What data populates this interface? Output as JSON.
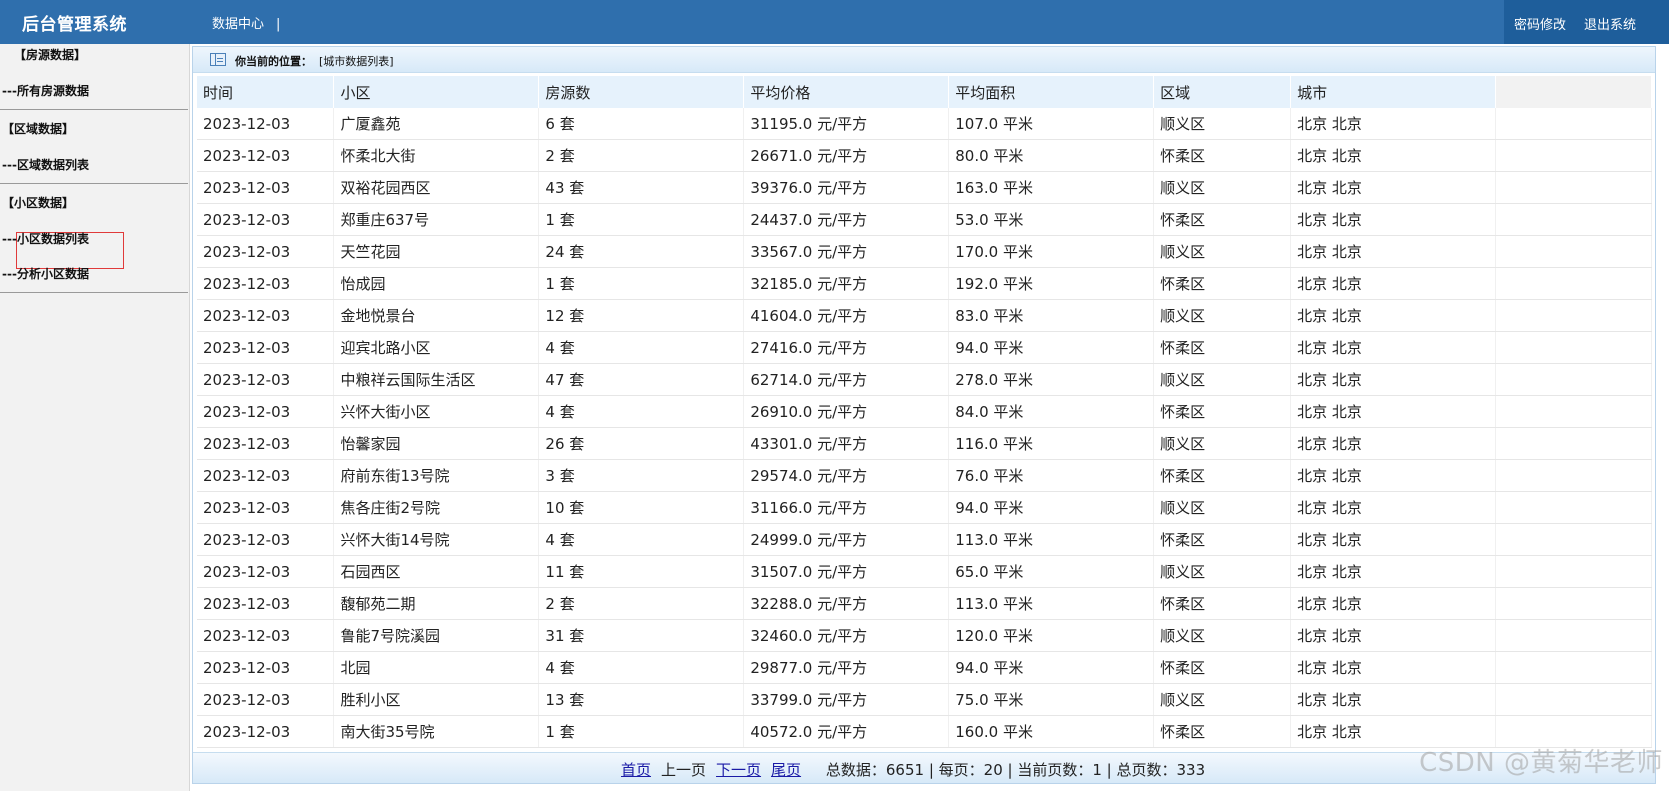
{
  "header": {
    "title": "后台管理系统",
    "nav": "数据中心",
    "nav_sep": "|",
    "password_change": "密码修改",
    "logout": "退出系统"
  },
  "sidebar": {
    "groups": [
      {
        "title": "【房源数据】",
        "items": [
          "---所有房源数据"
        ]
      },
      {
        "title": "【区域数据】",
        "items": [
          "---区域数据列表"
        ]
      },
      {
        "title": "【小区数据】",
        "items": [
          "---小区数据列表",
          "---分析小区数据"
        ]
      }
    ],
    "active_item": "---小区数据列表"
  },
  "location": {
    "label": "你当前的位置：",
    "value": "[城市数据列表]"
  },
  "table": {
    "columns": [
      "时间",
      "小区",
      "房源数",
      "平均价格",
      "平均面积",
      "区域",
      "城市"
    ],
    "rows": [
      [
        "2023-12-03",
        "广厦鑫苑",
        "6 套",
        "31195.0 元/平方",
        "107.0 平米",
        "顺义区",
        "北京 北京"
      ],
      [
        "2023-12-03",
        "怀柔北大街",
        "2 套",
        "26671.0 元/平方",
        "80.0 平米",
        "怀柔区",
        "北京 北京"
      ],
      [
        "2023-12-03",
        "双裕花园西区",
        "43 套",
        "39376.0 元/平方",
        "163.0 平米",
        "顺义区",
        "北京 北京"
      ],
      [
        "2023-12-03",
        "郑重庄637号",
        "1 套",
        "24437.0 元/平方",
        "53.0 平米",
        "怀柔区",
        "北京 北京"
      ],
      [
        "2023-12-03",
        "天竺花园",
        "24 套",
        "33567.0 元/平方",
        "170.0 平米",
        "顺义区",
        "北京 北京"
      ],
      [
        "2023-12-03",
        "怡成园",
        "1 套",
        "32185.0 元/平方",
        "192.0 平米",
        "怀柔区",
        "北京 北京"
      ],
      [
        "2023-12-03",
        "金地悦景台",
        "12 套",
        "41604.0 元/平方",
        "83.0 平米",
        "顺义区",
        "北京 北京"
      ],
      [
        "2023-12-03",
        "迎宾北路小区",
        "4 套",
        "27416.0 元/平方",
        "94.0 平米",
        "怀柔区",
        "北京 北京"
      ],
      [
        "2023-12-03",
        "中粮祥云国际生活区",
        "47 套",
        "62714.0 元/平方",
        "278.0 平米",
        "顺义区",
        "北京 北京"
      ],
      [
        "2023-12-03",
        "兴怀大街小区",
        "4 套",
        "26910.0 元/平方",
        "84.0 平米",
        "怀柔区",
        "北京 北京"
      ],
      [
        "2023-12-03",
        "怡馨家园",
        "26 套",
        "43301.0 元/平方",
        "116.0 平米",
        "顺义区",
        "北京 北京"
      ],
      [
        "2023-12-03",
        "府前东街13号院",
        "3 套",
        "29574.0 元/平方",
        "76.0 平米",
        "怀柔区",
        "北京 北京"
      ],
      [
        "2023-12-03",
        "焦各庄街2号院",
        "10 套",
        "31166.0 元/平方",
        "94.0 平米",
        "顺义区",
        "北京 北京"
      ],
      [
        "2023-12-03",
        "兴怀大街14号院",
        "4 套",
        "24999.0 元/平方",
        "113.0 平米",
        "怀柔区",
        "北京 北京"
      ],
      [
        "2023-12-03",
        "石园西区",
        "11 套",
        "31507.0 元/平方",
        "65.0 平米",
        "顺义区",
        "北京 北京"
      ],
      [
        "2023-12-03",
        "馥郁苑二期",
        "2 套",
        "32288.0 元/平方",
        "113.0 平米",
        "怀柔区",
        "北京 北京"
      ],
      [
        "2023-12-03",
        "鲁能7号院溪园",
        "31 套",
        "32460.0 元/平方",
        "120.0 平米",
        "顺义区",
        "北京 北京"
      ],
      [
        "2023-12-03",
        "北园",
        "4 套",
        "29877.0 元/平方",
        "94.0 平米",
        "怀柔区",
        "北京 北京"
      ],
      [
        "2023-12-03",
        "胜利小区",
        "13 套",
        "33799.0 元/平方",
        "75.0 平米",
        "顺义区",
        "北京 北京"
      ],
      [
        "2023-12-03",
        "南大街35号院",
        "1 套",
        "40572.0 元/平方",
        "160.0 平米",
        "怀柔区",
        "北京 北京"
      ]
    ]
  },
  "pagination": {
    "first": "首页",
    "prev": "上一页",
    "next": "下一页",
    "last": "尾页",
    "total_label": "总数据：",
    "total": "6651",
    "per_page_label": "每页：",
    "per_page": "20",
    "current_label": "当前页数：",
    "current": "1",
    "pages_label": "总页数：",
    "pages": "333"
  },
  "watermark": "CSDN @黄菊华老师",
  "colors": {
    "header_bg": "#2f6fad",
    "header_right_bg": "#1e5e9b",
    "sidebar_bg": "#f2f2f2",
    "table_header_bg": "#e6f2fc",
    "active_border": "#e03a3a",
    "link": "#1a1aa6"
  }
}
